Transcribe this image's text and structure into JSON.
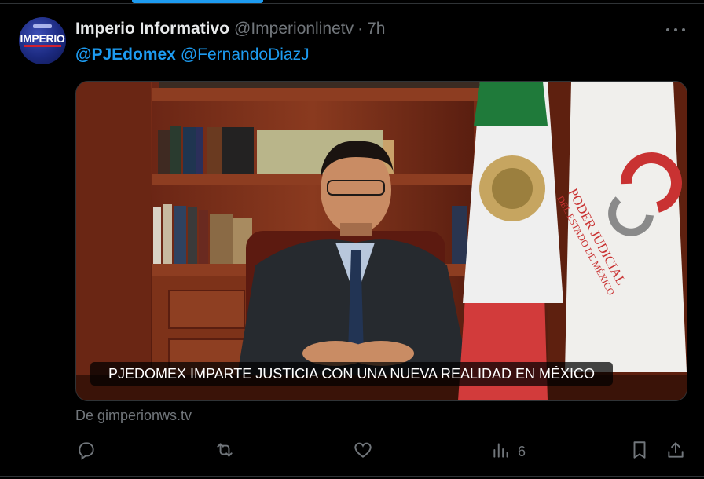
{
  "author": {
    "display_name": "Imperio Informativo",
    "handle": "@Imperionlinetv",
    "separator": "·",
    "time_ago": "7h",
    "avatar_text": "IMPERIO"
  },
  "tweet": {
    "mentions": [
      "@PJEdomex",
      "@FernandoDiazJ"
    ]
  },
  "media": {
    "caption": "PJEDOMEX IMPARTE JUSTICIA CON UNA NUEVA REALIDAD EN MÉXICO",
    "flag_text_line1": "PODER JUDICIAL",
    "flag_text_line2": "DEL ESTADO DE MÉXICO"
  },
  "link_source": "De gimperionws.tv",
  "actions": {
    "reply_icon": "reply-icon",
    "retweet_icon": "retweet-icon",
    "like_icon": "like-icon",
    "views_icon": "views-icon",
    "views_count": "6",
    "bookmark_icon": "bookmark-icon",
    "share_icon": "share-icon"
  },
  "colors": {
    "accent": "#1d9bf0",
    "muted": "#71767b",
    "background": "#000000",
    "text": "#e7e9ea"
  }
}
